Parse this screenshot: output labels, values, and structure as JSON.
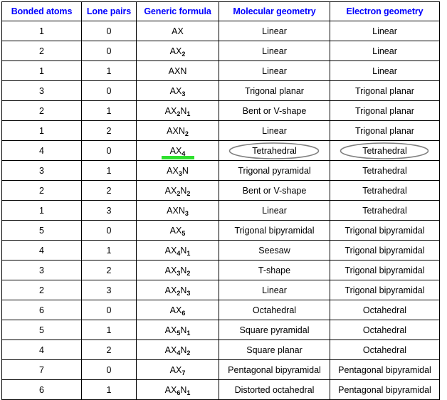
{
  "table": {
    "headers": [
      "Bonded atoms",
      "Lone pairs",
      "Generic formula",
      "Molecular geometry",
      "Electron geometry"
    ],
    "colors": {
      "header_text": "#0000FF",
      "formula_text": "#FF0000",
      "body_text": "#000000",
      "border": "#000000",
      "background": "#FFFFFF",
      "highlight_underline": "#2EE02E",
      "annotation_circle": "#808080"
    },
    "annotations": {
      "underlined_formula_row_index": 6,
      "circled_cells": [
        {
          "row_index": 6,
          "column": "Molecular geometry",
          "text": "Tetrahedral"
        },
        {
          "row_index": 6,
          "column": "Electron geometry",
          "text": "Tetrahedral"
        }
      ]
    },
    "rows": [
      {
        "bonded_atoms": "1",
        "lone_pairs": "0",
        "formula": {
          "base": "AX",
          "sub1": "",
          "tail": "",
          "sub2": ""
        },
        "molecular_geometry": "Linear",
        "electron_geometry": "Linear"
      },
      {
        "bonded_atoms": "2",
        "lone_pairs": "0",
        "formula": {
          "base": "AX",
          "sub1": "2",
          "tail": "",
          "sub2": ""
        },
        "molecular_geometry": "Linear",
        "electron_geometry": "Linear"
      },
      {
        "bonded_atoms": "1",
        "lone_pairs": "1",
        "formula": {
          "base": "AX",
          "sub1": "",
          "tail": "N",
          "sub2": ""
        },
        "molecular_geometry": "Linear",
        "electron_geometry": "Linear"
      },
      {
        "bonded_atoms": "3",
        "lone_pairs": "0",
        "formula": {
          "base": "AX",
          "sub1": "3",
          "tail": "",
          "sub2": ""
        },
        "molecular_geometry": "Trigonal planar",
        "electron_geometry": "Trigonal planar"
      },
      {
        "bonded_atoms": "2",
        "lone_pairs": "1",
        "formula": {
          "base": "AX",
          "sub1": "2",
          "tail": "N",
          "sub2": "1"
        },
        "molecular_geometry": "Bent or V-shape",
        "electron_geometry": "Trigonal planar"
      },
      {
        "bonded_atoms": "1",
        "lone_pairs": "2",
        "formula": {
          "base": "AX",
          "sub1": "",
          "tail": "N",
          "sub2": "2"
        },
        "molecular_geometry": "Linear",
        "electron_geometry": "Trigonal planar"
      },
      {
        "bonded_atoms": "4",
        "lone_pairs": "0",
        "formula": {
          "base": "AX",
          "sub1": "4",
          "tail": "",
          "sub2": ""
        },
        "molecular_geometry": "Tetrahedral",
        "electron_geometry": "Tetrahedral"
      },
      {
        "bonded_atoms": "3",
        "lone_pairs": "1",
        "formula": {
          "base": "AX",
          "sub1": "3",
          "tail": "N",
          "sub2": ""
        },
        "molecular_geometry": "Trigonal pyramidal",
        "electron_geometry": "Tetrahedral"
      },
      {
        "bonded_atoms": "2",
        "lone_pairs": "2",
        "formula": {
          "base": "AX",
          "sub1": "2",
          "tail": "N",
          "sub2": "2"
        },
        "molecular_geometry": "Bent or V-shape",
        "electron_geometry": "Tetrahedral"
      },
      {
        "bonded_atoms": "1",
        "lone_pairs": "3",
        "formula": {
          "base": "AX",
          "sub1": "",
          "tail": "N",
          "sub2": "3"
        },
        "molecular_geometry": "Linear",
        "electron_geometry": "Tetrahedral"
      },
      {
        "bonded_atoms": "5",
        "lone_pairs": "0",
        "formula": {
          "base": "AX",
          "sub1": "5",
          "tail": "",
          "sub2": ""
        },
        "molecular_geometry": "Trigonal bipyramidal",
        "electron_geometry": "Trigonal bipyramidal"
      },
      {
        "bonded_atoms": "4",
        "lone_pairs": "1",
        "formula": {
          "base": "AX",
          "sub1": "4",
          "tail": "N",
          "sub2": "1"
        },
        "molecular_geometry": "Seesaw",
        "electron_geometry": "Trigonal bipyramidal"
      },
      {
        "bonded_atoms": "3",
        "lone_pairs": "2",
        "formula": {
          "base": "AX",
          "sub1": "3",
          "tail": "N",
          "sub2": "2"
        },
        "molecular_geometry": "T-shape",
        "electron_geometry": "Trigonal bipyramidal"
      },
      {
        "bonded_atoms": "2",
        "lone_pairs": "3",
        "formula": {
          "base": "AX",
          "sub1": "2",
          "tail": "N",
          "sub2": "3"
        },
        "molecular_geometry": "Linear",
        "electron_geometry": "Trigonal bipyramidal"
      },
      {
        "bonded_atoms": "6",
        "lone_pairs": "0",
        "formula": {
          "base": "AX",
          "sub1": "6",
          "tail": "",
          "sub2": ""
        },
        "molecular_geometry": "Octahedral",
        "electron_geometry": "Octahedral"
      },
      {
        "bonded_atoms": "5",
        "lone_pairs": "1",
        "formula": {
          "base": "AX",
          "sub1": "5",
          "tail": "N",
          "sub2": "1"
        },
        "molecular_geometry": "Square pyramidal",
        "electron_geometry": "Octahedral"
      },
      {
        "bonded_atoms": "4",
        "lone_pairs": "2",
        "formula": {
          "base": "AX",
          "sub1": "4",
          "tail": "N",
          "sub2": "2"
        },
        "molecular_geometry": "Square planar",
        "electron_geometry": "Octahedral"
      },
      {
        "bonded_atoms": "7",
        "lone_pairs": "0",
        "formula": {
          "base": "AX",
          "sub1": "7",
          "tail": "",
          "sub2": ""
        },
        "molecular_geometry": "Pentagonal bipyramidal",
        "electron_geometry": "Pentagonal bipyramidal"
      },
      {
        "bonded_atoms": "6",
        "lone_pairs": "1",
        "formula": {
          "base": "AX",
          "sub1": "6",
          "tail": "N",
          "sub2": "1"
        },
        "molecular_geometry": "Distorted octahedral",
        "electron_geometry": "Pentagonal bipyramidal"
      }
    ]
  }
}
